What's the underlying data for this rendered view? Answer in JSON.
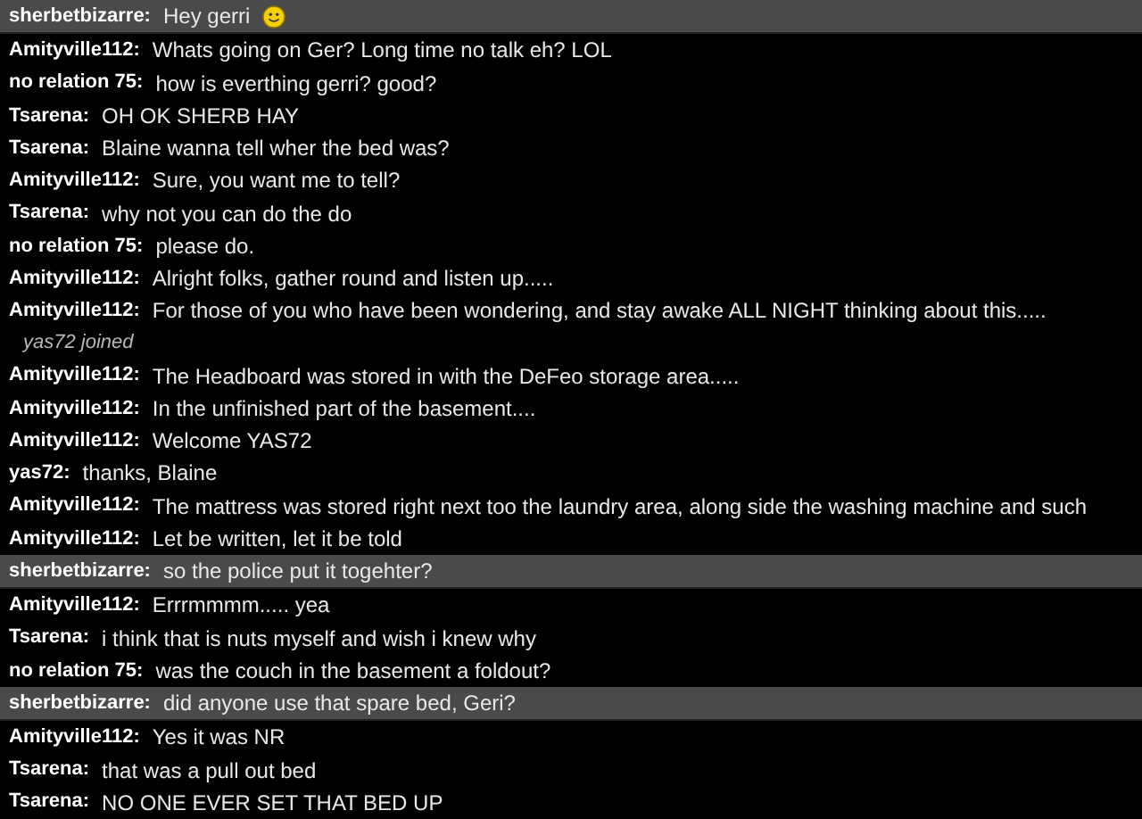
{
  "messages": [
    {
      "kind": "message",
      "highlighted": true,
      "user": "sherbetbizarre:",
      "text": "Hey gerri",
      "emoticon": true
    },
    {
      "kind": "message",
      "highlighted": false,
      "user": "Amityville112:",
      "text": "Whats going on Ger? Long time no talk eh? LOL"
    },
    {
      "kind": "message",
      "highlighted": false,
      "user": "no relation 75:",
      "text": "how is everthing gerri? good?"
    },
    {
      "kind": "message",
      "highlighted": false,
      "user": "Tsarena:",
      "text": "OH OK SHERB HAY"
    },
    {
      "kind": "message",
      "highlighted": false,
      "user": "Tsarena:",
      "text": "Blaine wanna tell wher the bed was?"
    },
    {
      "kind": "message",
      "highlighted": false,
      "user": "Amityville112:",
      "text": "Sure, you want me to tell?"
    },
    {
      "kind": "message",
      "highlighted": false,
      "user": "Tsarena:",
      "text": "why not you can do the do"
    },
    {
      "kind": "message",
      "highlighted": false,
      "user": "no relation 75:",
      "text": "please do."
    },
    {
      "kind": "message",
      "highlighted": false,
      "user": "Amityville112:",
      "text": "Alright folks, gather round and listen up....."
    },
    {
      "kind": "message",
      "highlighted": false,
      "user": "Amityville112:",
      "text": "For those of you who have been wondering, and stay awake ALL NIGHT thinking about this....."
    },
    {
      "kind": "event",
      "text": "yas72 joined"
    },
    {
      "kind": "message",
      "highlighted": false,
      "user": "Amityville112:",
      "text": "The Headboard was stored in with the DeFeo storage area....."
    },
    {
      "kind": "message",
      "highlighted": false,
      "user": "Amityville112:",
      "text": "In the unfinished part of the basement...."
    },
    {
      "kind": "message",
      "highlighted": false,
      "user": "Amityville112:",
      "text": "Welcome YAS72"
    },
    {
      "kind": "message",
      "highlighted": false,
      "user": "yas72:",
      "text": "thanks, Blaine"
    },
    {
      "kind": "message",
      "highlighted": false,
      "user": "Amityville112:",
      "text": "The mattress was stored right next too the laundry area, along side the washing machine and such"
    },
    {
      "kind": "message",
      "highlighted": false,
      "user": "Amityville112:",
      "text": "Let be written, let it be told"
    },
    {
      "kind": "message",
      "highlighted": true,
      "user": "sherbetbizarre:",
      "text": "so the police put it togehter?"
    },
    {
      "kind": "message",
      "highlighted": false,
      "user": "Amityville112:",
      "text": "Errrmmmm..... yea"
    },
    {
      "kind": "message",
      "highlighted": false,
      "user": "Tsarena:",
      "text": "i think that is nuts myself and wish i knew why"
    },
    {
      "kind": "message",
      "highlighted": false,
      "user": "no relation 75:",
      "text": "was the couch in the basement a foldout?"
    },
    {
      "kind": "message",
      "highlighted": true,
      "user": "sherbetbizarre:",
      "text": "did anyone use that spare bed, Geri?"
    },
    {
      "kind": "message",
      "highlighted": false,
      "user": "Amityville112:",
      "text": "Yes it was NR"
    },
    {
      "kind": "message",
      "highlighted": false,
      "user": "Tsarena:",
      "text": "that was a pull out bed"
    },
    {
      "kind": "message",
      "highlighted": false,
      "user": "Tsarena:",
      "text": "NO ONE EVER SET THAT BED UP"
    }
  ]
}
